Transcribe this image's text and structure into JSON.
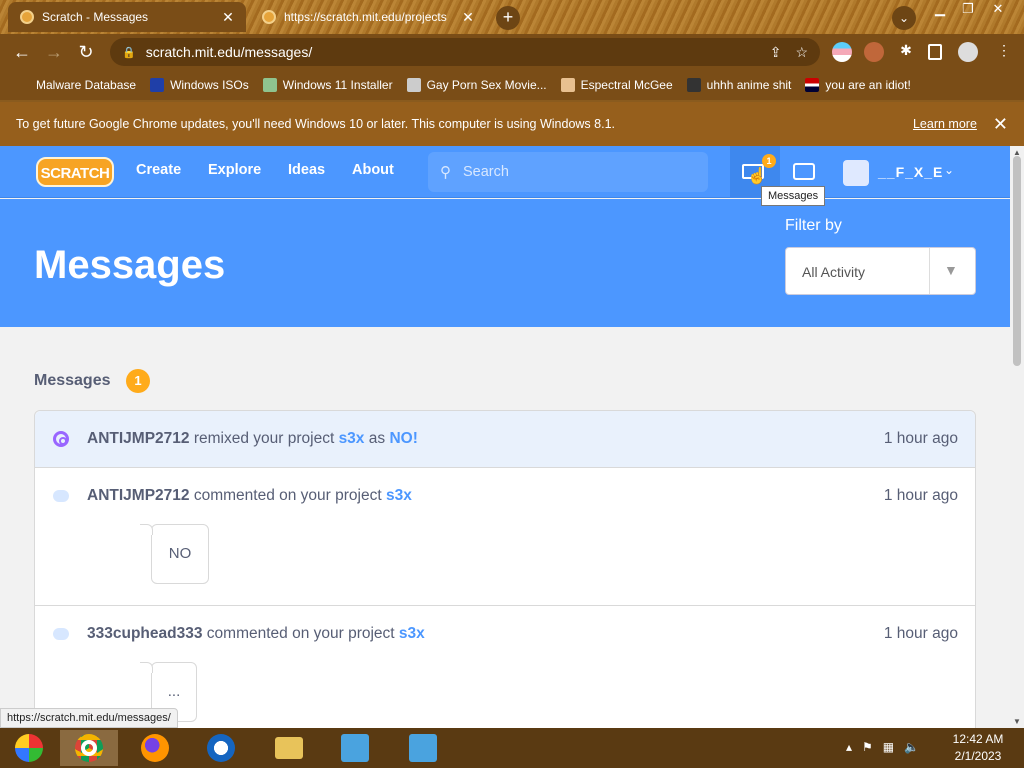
{
  "browser": {
    "tabs": [
      {
        "title": "Scratch - Messages",
        "active": true
      },
      {
        "title": "https://scratch.mit.edu/projects",
        "active": false
      }
    ],
    "new_tab": "+",
    "url": "scratch.mit.edu/messages/",
    "bookmarks": [
      {
        "label": "Malware Database",
        "icon": "sheet-icon"
      },
      {
        "label": "Windows ISOs",
        "icon": "x-icon"
      },
      {
        "label": "Windows 11 Installer",
        "icon": "image-icon"
      },
      {
        "label": "Gay Porn Sex Movie...",
        "icon": "globe-icon"
      },
      {
        "label": "Espectral McGee",
        "icon": "face-icon"
      },
      {
        "label": "uhhh anime shit",
        "icon": "anime-icon"
      },
      {
        "label": "you are an idiot!",
        "icon": "flag-icon"
      }
    ],
    "infobar": {
      "text": "To get future Google Chrome updates, you'll need Windows 10 or later. This computer is using Windows 8.1.",
      "link": "Learn more"
    },
    "status_url": "https://scratch.mit.edu/messages/"
  },
  "scratch": {
    "logo": "SCRATCH",
    "nav": [
      "Create",
      "Explore",
      "Ideas",
      "About"
    ],
    "search_placeholder": "Search",
    "messages_badge": "1",
    "tooltip": "Messages",
    "username": "__F_X_E",
    "hero_title": "Messages",
    "filter_label": "Filter by",
    "filter_value": "All Activity",
    "list_title": "Messages",
    "list_count": "1",
    "messages": [
      {
        "user": "ANTIJMP2712",
        "action": "remixed your project",
        "project": "s3x",
        "mid": "as",
        "target": "NO!",
        "time": "1 hour ago"
      },
      {
        "user": "ANTIJMP2712",
        "action": "commented on your project",
        "project": "s3x",
        "comment": "NO",
        "time": "1 hour ago"
      },
      {
        "user": "333cuphead333",
        "action": "commented on your project",
        "project": "s3x",
        "comment": "...",
        "time": "1 hour ago"
      }
    ]
  },
  "taskbar": {
    "time": "12:42 AM",
    "date": "2/1/2023"
  },
  "colors": {
    "scratch_blue": "#4c97ff",
    "badge_orange": "#ffab1a",
    "text_gray": "#575e75"
  }
}
